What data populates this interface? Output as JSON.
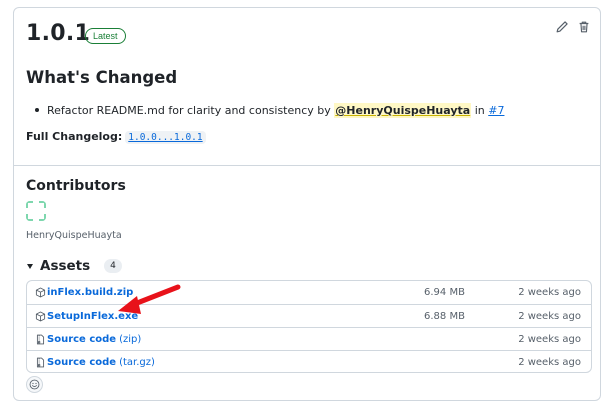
{
  "release": {
    "tag": "1.0.1",
    "badge": "Latest"
  },
  "toolbar": {
    "edit_icon": "pencil-icon",
    "delete_icon": "trash-icon"
  },
  "notes": {
    "heading": "What's Changed",
    "item_text": "Refactor README.md for clarity and consistency by",
    "item_author": "@HenryQuispeHuayta",
    "item_in": "in",
    "item_pr": "#7",
    "changelog_label": "Full Changelog:",
    "changelog_range": "1.0.0...1.0.1"
  },
  "contributors": {
    "heading": "Contributors",
    "names": [
      "HenryQuispeHuayta"
    ]
  },
  "assets": {
    "heading": "Assets",
    "count": "4",
    "items": [
      {
        "name": "inFlex.build.zip",
        "suffix": "",
        "size": "6.94 MB",
        "date": "2 weeks ago",
        "icon": "package-icon"
      },
      {
        "name": "SetupInFlex.exe",
        "suffix": "",
        "size": "6.88 MB",
        "date": "2 weeks ago",
        "icon": "package-icon"
      },
      {
        "name": "Source code",
        "suffix": "(zip)",
        "size": "",
        "date": "2 weeks ago",
        "icon": "file-zip-icon"
      },
      {
        "name": "Source code",
        "suffix": "(tar.gz)",
        "size": "",
        "date": "2 weeks ago",
        "icon": "file-zip-icon"
      }
    ]
  },
  "colors": {
    "accent": "#0969da",
    "badge": "#1a7f37",
    "arrow": "#e8121a",
    "mention_bg": "#fff8c5"
  }
}
